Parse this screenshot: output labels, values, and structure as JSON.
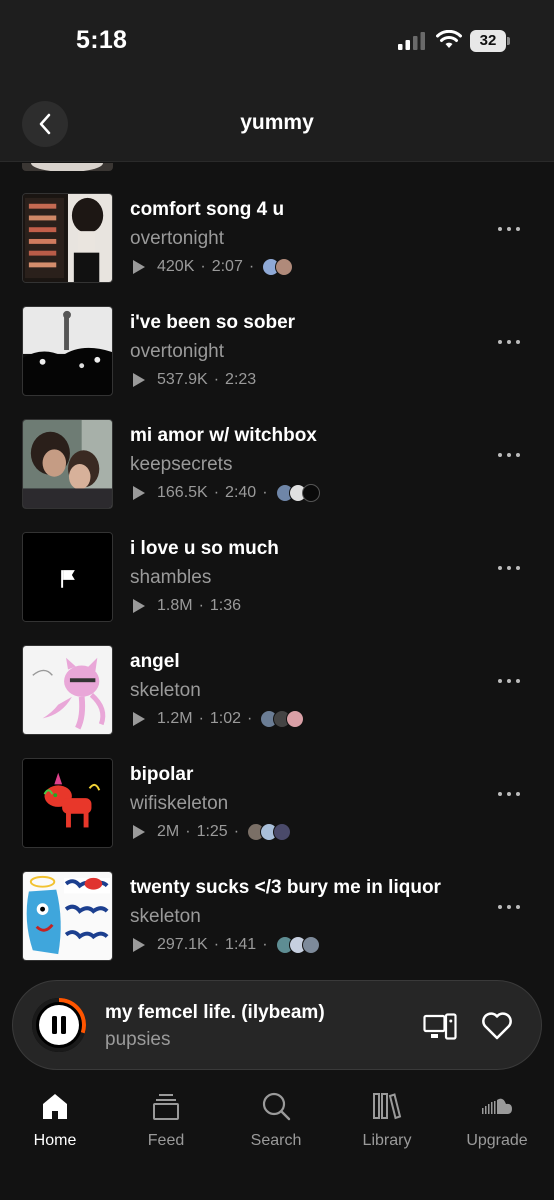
{
  "status_bar": {
    "time": "5:18",
    "battery": "32"
  },
  "header": {
    "title": "yummy"
  },
  "tracks": [
    {
      "title": "comfort song 4 u",
      "artist": "overtonight",
      "plays": "420K",
      "duration": "2:07",
      "avatars": [
        "#8fa9d6",
        "#b08a7a"
      ]
    },
    {
      "title": "i've been so sober",
      "artist": "overtonight",
      "plays": "537.9K",
      "duration": "2:23",
      "avatars": []
    },
    {
      "title": "mi amor w/ witchbox",
      "artist": "keepsecrets",
      "plays": "166.5K",
      "duration": "2:40",
      "avatars": [
        "#6f86a8",
        "#e0e0e0",
        "#0a0a0a"
      ]
    },
    {
      "title": "i love u so much",
      "artist": "shambles",
      "plays": "1.8M",
      "duration": "1:36",
      "avatars": []
    },
    {
      "title": "angel",
      "artist": "skeleton",
      "plays": "1.2M",
      "duration": "1:02",
      "avatars": [
        "#6b7d95",
        "#444444",
        "#d9a0a6"
      ]
    },
    {
      "title": "bipolar",
      "artist": "wifiskeleton",
      "plays": "2M",
      "duration": "1:25",
      "avatars": [
        "#7a6f66",
        "#a9bfd9",
        "#4a4a6a"
      ]
    },
    {
      "title": "twenty sucks </3 bury me in liquor",
      "artist": "skeleton",
      "plays": "297.1K",
      "duration": "1:41",
      "avatars": [
        "#5e8d93",
        "#c6cfdf",
        "#7d8a9a"
      ]
    }
  ],
  "mini_player": {
    "title": "my femcel life. (ilybeam)",
    "artist": "pupsies",
    "progress": 0.3,
    "accent": "#ff5500"
  },
  "tabs": [
    {
      "label": "Home",
      "icon": "home-icon",
      "active": true
    },
    {
      "label": "Feed",
      "icon": "feed-icon",
      "active": false
    },
    {
      "label": "Search",
      "icon": "search-icon",
      "active": false
    },
    {
      "label": "Library",
      "icon": "library-icon",
      "active": false
    },
    {
      "label": "Upgrade",
      "icon": "soundcloud-icon",
      "active": false
    }
  ]
}
